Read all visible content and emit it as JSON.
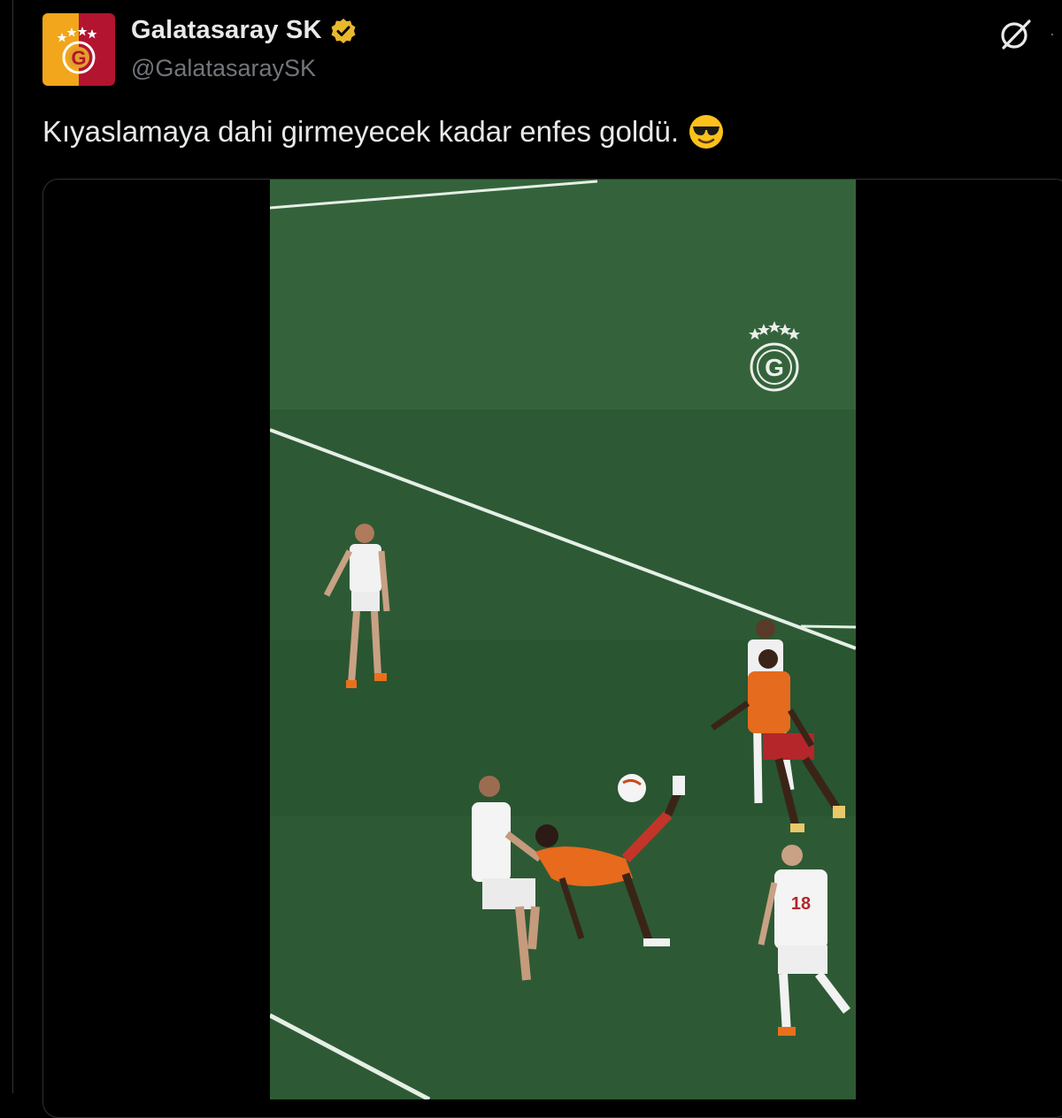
{
  "post": {
    "display_name": "Galatasaray SK",
    "handle": "@GalatasaraySK",
    "text": "Kıyaslamaya dahi girmeyecek kadar enfes goldü.",
    "emoji_name": "smiling-face-with-sunglasses",
    "verified_color": "#e8b82e"
  },
  "icons": {
    "grok": "grok-icon",
    "more": "more-icon"
  },
  "media": {
    "type": "video",
    "description_colors": {
      "pitch": "#2e5a35",
      "home_kit": "#e86a1c",
      "away_kit": "#f2f2f2"
    }
  }
}
